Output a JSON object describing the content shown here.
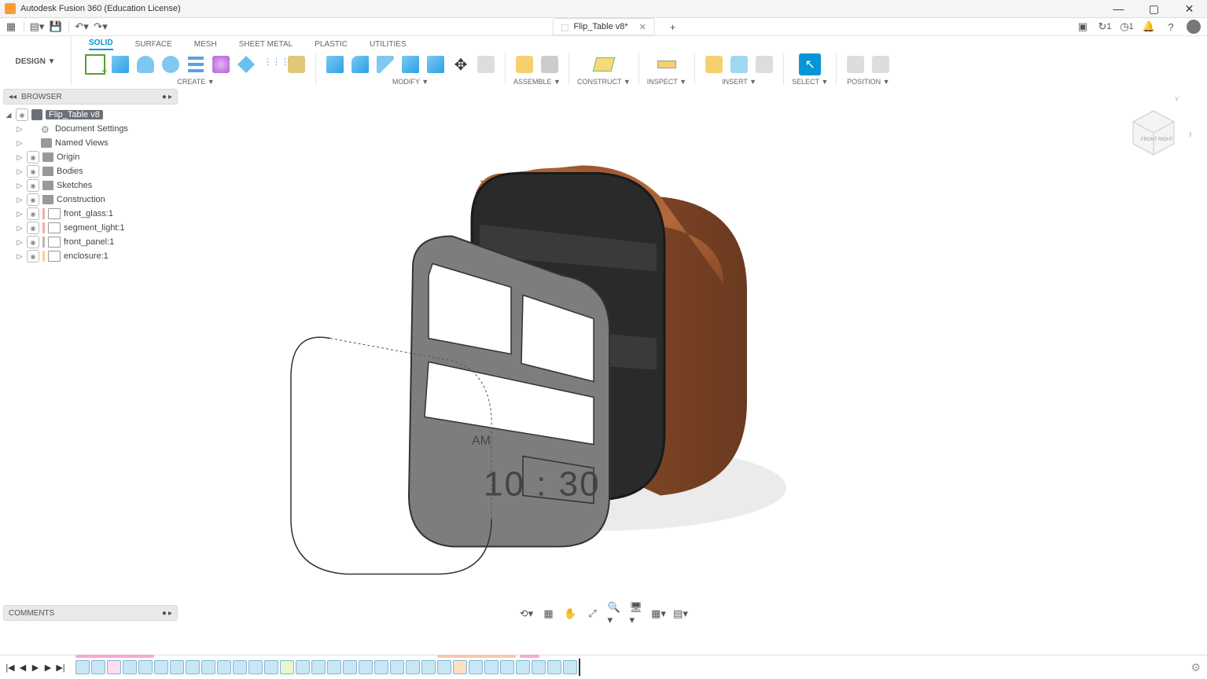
{
  "app_title": "Autodesk Fusion 360 (Education License)",
  "doc_tab": "Flip_Table v8*",
  "workspace": "DESIGN",
  "subtabs": [
    "SOLID",
    "SURFACE",
    "MESH",
    "SHEET METAL",
    "PLASTIC",
    "UTILITIES"
  ],
  "active_subtab": 0,
  "groups": {
    "create": "CREATE",
    "modify": "MODIFY",
    "assemble": "ASSEMBLE",
    "construct": "CONSTRUCT",
    "inspect": "INSPECT",
    "insert": "INSERT",
    "select": "SELECT",
    "position": "POSITION"
  },
  "panels": {
    "browser": "BROWSER",
    "comments": "COMMENTS"
  },
  "tree": {
    "root": "Flip_Table v8",
    "items": [
      {
        "label": "Document Settings",
        "icon": "gear"
      },
      {
        "label": "Named Views",
        "icon": "folder"
      },
      {
        "label": "Origin",
        "icon": "folder",
        "eye": true,
        "dim": true
      },
      {
        "label": "Bodies",
        "icon": "folder",
        "eye": true
      },
      {
        "label": "Sketches",
        "icon": "folder",
        "eye": true
      },
      {
        "label": "Construction",
        "icon": "folder",
        "eye": true
      },
      {
        "label": "front_glass:1",
        "icon": "comp",
        "eye": true,
        "color": "#f7a9a9"
      },
      {
        "label": "segment_light:1",
        "icon": "comp",
        "eye": true,
        "color": "#f7a9a9"
      },
      {
        "label": "front_panel:1",
        "icon": "comp",
        "eye": true,
        "color": "#b8b8b8"
      },
      {
        "label": "enclosure:1",
        "icon": "comp",
        "eye": true,
        "color": "#f5d580"
      }
    ]
  },
  "clock": {
    "ampm": "AM",
    "time": "10 : 30"
  },
  "notif_count": "1",
  "job_count": "1"
}
